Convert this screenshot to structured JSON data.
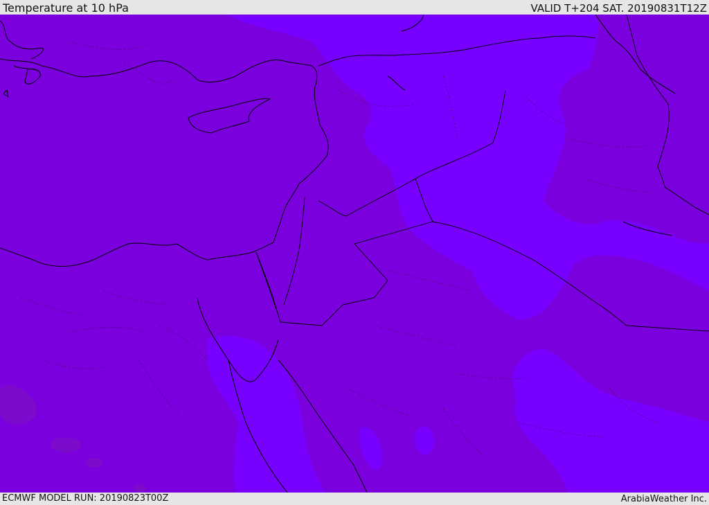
{
  "header": {
    "title": "Temperature at 10 hPa",
    "valid": "VALID T+204 SAT. 20190831T12Z"
  },
  "footer": {
    "model_run": "ECMWF MODEL RUN: 20190823T00Z",
    "brand": "ArabiaWeather Inc."
  },
  "colors": {
    "region_base": "#7a00de",
    "region_warm": "#7700ff",
    "region_cool": "#7b0ccc",
    "frame_background": "#e6e6e6",
    "coastline": "#000000"
  }
}
